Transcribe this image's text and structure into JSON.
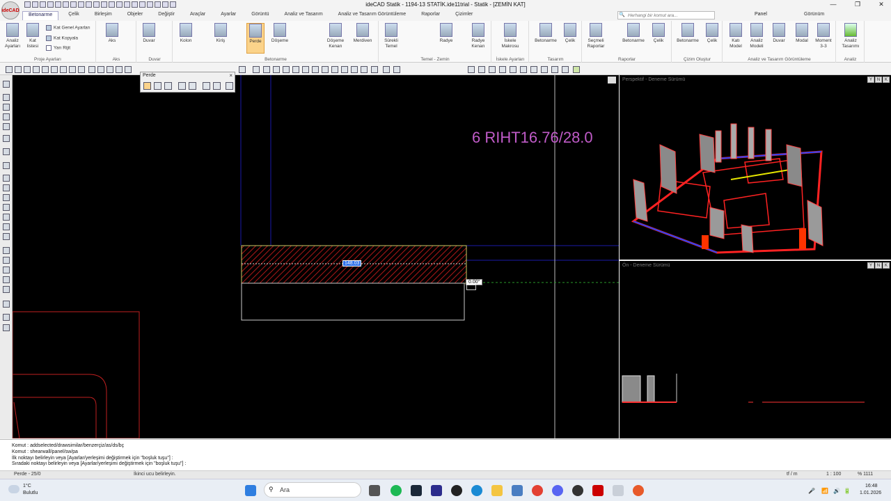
{
  "window": {
    "title": "ideCAD Statik - 1194-13 STATİK.ide11trial - Statik - [ZEMİN KAT]",
    "logo_text": "ideCAD",
    "minimize": "—",
    "maximize": "❐",
    "close": "✕"
  },
  "menu_tabs": [
    "Betonarme",
    "Çelik",
    "Birleşim",
    "Objeler",
    "Değiştir",
    "Araçlar",
    "Ayarlar",
    "Görüntü",
    "Analiz ve Tasarım",
    "Analiz ve Tasarım Görüntüleme",
    "Raporlar",
    "Çizimler"
  ],
  "active_tab": "Betonarme",
  "command_search": {
    "placeholder": "Herhangi bir komut ara..."
  },
  "panel_label": "Panel",
  "gorunum_label": "Görünüm",
  "ribbon": {
    "groups": [
      {
        "title": "Proje Ayarları"
      },
      {
        "title": "Aks"
      },
      {
        "title": "Duvar"
      },
      {
        "title": "Betonarme"
      },
      {
        "title": "Temel - Zemin"
      },
      {
        "title": "İskele Ayarları"
      },
      {
        "title": "Tasarım"
      },
      {
        "title": "Raporlar"
      },
      {
        "title": "Çizim Oluştur"
      },
      {
        "title": "Analiz ve Tasarım Görüntüleme"
      },
      {
        "title": "Analiz"
      }
    ],
    "buttons": [
      "Analiz Ayarları",
      "Kat listesi",
      "Aks",
      "Duvar",
      "Kolon",
      "Kiriş",
      "Perde",
      "Döşeme",
      "Döşeme Kenarı",
      "Merdiven",
      "Sürekli Temel",
      "Radye",
      "Radye Kenarı",
      "İskele Makrosu",
      "Betonarme",
      "Çelik",
      "Seçmeli Raporlar",
      "Betonarme",
      "Çelik",
      "Betonarme",
      "Çelik",
      "Katı Model",
      "Analiz Modeli",
      "Duvar",
      "Modal",
      "Moment 3-3",
      "Analiz Tasarımı"
    ],
    "small_items": [
      "Kat Genel Ayarları",
      "Kat Kopyala",
      "Yarı Rijit"
    ]
  },
  "perde_toolbar": {
    "title": "Perde",
    "close": "×"
  },
  "canvas": {
    "riht_label": "6 RIHT16.76/28.0",
    "dimension_value": "148.03",
    "angle_value": "0.00°"
  },
  "views": {
    "perspective_label": "Perspektif - Deneme Sürümü",
    "front_label": "Ön - Deneme Sürümü",
    "view_buttons": [
      "Y",
      "N",
      "K"
    ]
  },
  "command_lines": [
    "Komut : addselected/drawsimilar/benzerçiz/as/ds/bç",
    "Komut : shearwall/panel/sw/pa",
    "İlk noktayı belirleyin veya [Ayarlar/yerleşimi değiştirmek için \"boşluk tuşu\"] :",
    "Sıradaki noktayı belirleyin veya [Ayarlar/yerleşimi değiştirmek için \"boşluk tuşu\"] :"
  ],
  "status": {
    "left": "Perde - 25/0",
    "middle": "İkinci ucu belirleyin.",
    "units": "tf / m",
    "scale": "1 : 100",
    "zoom": "% 1111"
  },
  "taskbar": {
    "weather_temp": "1°C",
    "weather_desc": "Bulutlu",
    "search": "Ara",
    "time": "16:48",
    "date": "1.01.2026"
  },
  "colors": {
    "canvas_bg": "#000000",
    "wall_hatch": "#b01818",
    "riht_text": "#c05bc8",
    "axis_blue": "#1a1aaa",
    "selected_ribbon": "#fbd38a"
  }
}
